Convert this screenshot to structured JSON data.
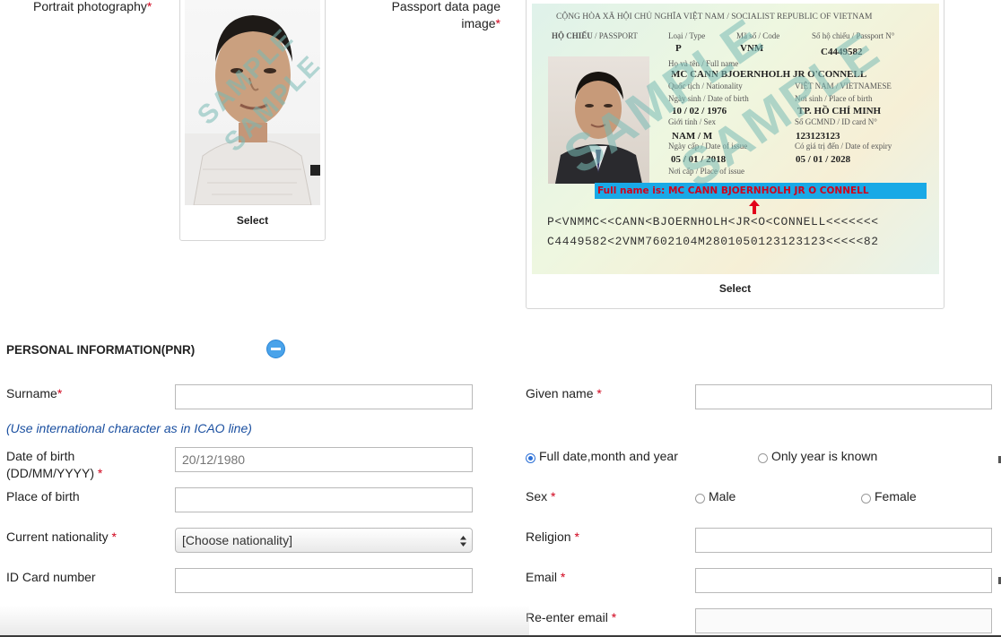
{
  "photo": {
    "label": "Portrait photography",
    "required": "*",
    "select": "Select",
    "watermark": "SAMPLE"
  },
  "passport": {
    "label_line1": "Passport data page",
    "label_line2": "image",
    "required": "*",
    "select": "Select",
    "watermark": "SAMPLE",
    "header": "CỘNG HÒA XÃ HỘI CHỦ NGHĨA VIỆT NAM",
    "header_en": "SOCIALIST REPUBLIC OF VIETNAM",
    "doc_label": "HỘ CHIẾU",
    "doc_label_en": "/ PASSPORT",
    "type_label": "Loại / Type",
    "code_label": "Mã số / Code",
    "number_label": "Số hộ chiếu / Passport N°",
    "type_value": "P",
    "code_value": "VNM",
    "number_value": "C4449582",
    "name_label": "Họ và tên / Full name",
    "name_value": "MC CANN BJOERNHOLH JR O'CONNELL",
    "nationality_label": "Quốc tịch / Nationality",
    "nationality_value": "VIỆT NAM / VIETNAMESE",
    "dob_label": "Ngày sinh / Date of birth",
    "dob_value": "10 / 02 / 1976",
    "pob_label": "Nơi sinh / Place of birth",
    "pob_value": "TP. HỒ CHÍ MINH",
    "sex_label": "Giới tính / Sex",
    "sex_value": "NAM / M",
    "id_label": "Số GCMND / ID card N°",
    "id_value": "123123123",
    "issue_label": "Ngày cấp / Date of issue",
    "issue_value": "05 / 01 / 2018",
    "expiry_label": "Có giá trị đến / Date of expiry",
    "expiry_value": "05 / 01 / 2028",
    "poi_label": "Nơi cấp / Place of issue",
    "callout": "Full name is: MC CANN BJOERNHOLH JR O CONNELL",
    "mrz1": "P<VNMMC<<CANN<BJOERNHOLH<JR<O<CONNELL<<<<<<<",
    "mrz2": "C4449582<2VNM7602104M2801050123123123<<<<<82"
  },
  "section": {
    "title": "PERSONAL INFORMATION(PNR)",
    "collapse_icon": "minus-circle-icon"
  },
  "form": {
    "surname_label": "Surname",
    "given_name_label": "Given name",
    "icao_hint": "(Use international character as in ICAO line)",
    "dob_label_line1": "Date of birth",
    "dob_label_line2": "(DD/MM/YYYY)",
    "dob_placeholder": "20/12/1980",
    "dob_option_full": "Full date,month and year",
    "dob_option_year": "Only year is known",
    "place_of_birth_label": "Place of birth",
    "sex_label": "Sex",
    "sex_male": "Male",
    "sex_female": "Female",
    "nationality_label": "Current nationality",
    "nationality_value": "[Choose nationality]",
    "religion_label": "Religion",
    "id_card_label": "ID Card number",
    "email_label": "Email",
    "reenter_email_label": "Re-enter email",
    "required_mark": "*"
  },
  "colors": {
    "required": "#d0021b",
    "hint": "#1a4fa0",
    "accent": "#2b6fd6",
    "callout_bg": "#19a9e6"
  }
}
